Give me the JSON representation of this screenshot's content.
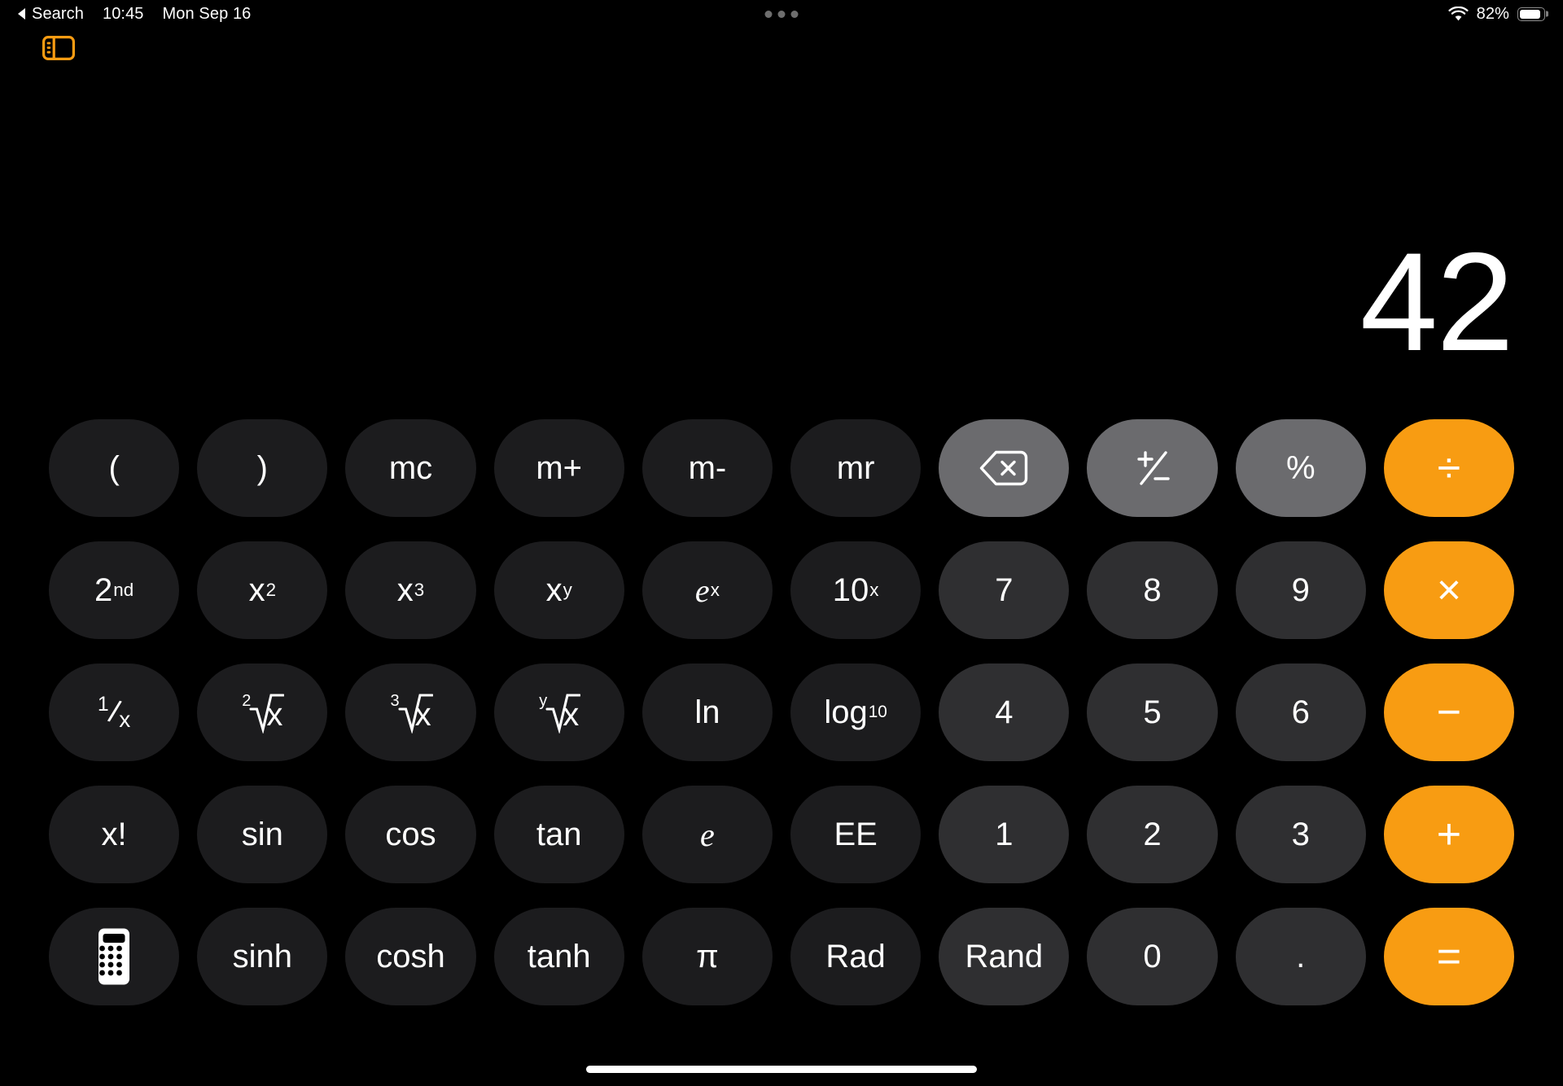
{
  "status_bar": {
    "back_label": "Search",
    "time": "10:45",
    "date": "Mon Sep 16",
    "wifi_icon": "wifi-icon",
    "battery_percent": "82%",
    "battery_level": 82,
    "multitask_icon": "multitask-dots-icon"
  },
  "toolbar": {
    "sidebar_toggle_icon": "sidebar-history-icon",
    "accent_color": "#F89C12"
  },
  "display": {
    "value": "42"
  },
  "colors": {
    "background": "#000000",
    "function_key": "#1C1C1E",
    "number_key": "#2F2F31",
    "utility_key": "#6B6B6E",
    "operator_key": "#F89C12",
    "key_text": "#FFFFFF"
  },
  "keypad": {
    "rows": [
      {
        "keys": [
          {
            "name": "open-paren-key",
            "label": "(",
            "type": "fn",
            "kind": "text"
          },
          {
            "name": "close-paren-key",
            "label": ")",
            "type": "fn",
            "kind": "text"
          },
          {
            "name": "memory-clear-key",
            "label": "mc",
            "type": "fn",
            "kind": "text"
          },
          {
            "name": "memory-add-key",
            "label": "m+",
            "type": "fn",
            "kind": "text"
          },
          {
            "name": "memory-subtract-key",
            "label": "m-",
            "type": "fn",
            "kind": "text"
          },
          {
            "name": "memory-recall-key",
            "label": "mr",
            "type": "fn",
            "kind": "text"
          },
          {
            "name": "backspace-key",
            "label": "",
            "type": "util",
            "kind": "icon",
            "icon": "backspace-delete-icon"
          },
          {
            "name": "sign-toggle-key",
            "label": "",
            "type": "util",
            "kind": "icon",
            "icon": "plus-minus-icon"
          },
          {
            "name": "percent-key",
            "label": "%",
            "type": "util",
            "kind": "text"
          },
          {
            "name": "divide-key",
            "label": "÷",
            "type": "op",
            "kind": "text"
          }
        ]
      },
      {
        "keys": [
          {
            "name": "second-function-key",
            "label": "2nd",
            "type": "fn",
            "kind": "sup",
            "base": "2",
            "sup": "nd"
          },
          {
            "name": "square-key",
            "label": "x2",
            "type": "fn",
            "kind": "sup",
            "base": "x",
            "sup": "2"
          },
          {
            "name": "cube-key",
            "label": "x3",
            "type": "fn",
            "kind": "sup",
            "base": "x",
            "sup": "3"
          },
          {
            "name": "power-y-key",
            "label": "xy",
            "type": "fn",
            "kind": "sup",
            "base": "x",
            "sup": "y"
          },
          {
            "name": "exp-e-key",
            "label": "ex",
            "type": "fn",
            "kind": "sup-ital",
            "base": "e",
            "sup": "x"
          },
          {
            "name": "exp-ten-key",
            "label": "10x",
            "type": "fn",
            "kind": "sup",
            "base": "10",
            "sup": "x"
          },
          {
            "name": "digit-7-key",
            "label": "7",
            "type": "num",
            "kind": "text"
          },
          {
            "name": "digit-8-key",
            "label": "8",
            "type": "num",
            "kind": "text"
          },
          {
            "name": "digit-9-key",
            "label": "9",
            "type": "num",
            "kind": "text"
          },
          {
            "name": "multiply-key",
            "label": "×",
            "type": "op",
            "kind": "text"
          }
        ]
      },
      {
        "keys": [
          {
            "name": "reciprocal-key",
            "label": "1/x",
            "type": "fn",
            "kind": "frac",
            "num": "1",
            "den": "x"
          },
          {
            "name": "square-root-key",
            "label": "2√x",
            "type": "fn",
            "kind": "radical",
            "index": "2"
          },
          {
            "name": "cube-root-key",
            "label": "3√x",
            "type": "fn",
            "kind": "radical",
            "index": "3"
          },
          {
            "name": "nth-root-key",
            "label": "y√x",
            "type": "fn",
            "kind": "radical",
            "index": "y"
          },
          {
            "name": "natural-log-key",
            "label": "ln",
            "type": "fn",
            "kind": "text"
          },
          {
            "name": "log-base-ten-key",
            "label": "log10",
            "type": "fn",
            "kind": "sub",
            "base": "log",
            "sub": "10"
          },
          {
            "name": "digit-4-key",
            "label": "4",
            "type": "num",
            "kind": "text"
          },
          {
            "name": "digit-5-key",
            "label": "5",
            "type": "num",
            "kind": "text"
          },
          {
            "name": "digit-6-key",
            "label": "6",
            "type": "num",
            "kind": "text"
          },
          {
            "name": "subtract-key",
            "label": "−",
            "type": "op",
            "kind": "text"
          }
        ]
      },
      {
        "keys": [
          {
            "name": "factorial-key",
            "label": "x!",
            "type": "fn",
            "kind": "text"
          },
          {
            "name": "sine-key",
            "label": "sin",
            "type": "fn",
            "kind": "text"
          },
          {
            "name": "cosine-key",
            "label": "cos",
            "type": "fn",
            "kind": "text"
          },
          {
            "name": "tangent-key",
            "label": "tan",
            "type": "fn",
            "kind": "text"
          },
          {
            "name": "euler-e-key",
            "label": "e",
            "type": "fn",
            "kind": "ital"
          },
          {
            "name": "ee-key",
            "label": "EE",
            "type": "fn",
            "kind": "text"
          },
          {
            "name": "digit-1-key",
            "label": "1",
            "type": "num",
            "kind": "text"
          },
          {
            "name": "digit-2-key",
            "label": "2",
            "type": "num",
            "kind": "text"
          },
          {
            "name": "digit-3-key",
            "label": "3",
            "type": "num",
            "kind": "text"
          },
          {
            "name": "add-key",
            "label": "+",
            "type": "op",
            "kind": "text"
          }
        ]
      },
      {
        "keys": [
          {
            "name": "basic-calculator-key",
            "label": "",
            "type": "fn",
            "kind": "icon",
            "icon": "calculator-icon"
          },
          {
            "name": "hyperbolic-sine-key",
            "label": "sinh",
            "type": "fn",
            "kind": "text"
          },
          {
            "name": "hyperbolic-cosine-key",
            "label": "cosh",
            "type": "fn",
            "kind": "text"
          },
          {
            "name": "hyperbolic-tangent-key",
            "label": "tanh",
            "type": "fn",
            "kind": "text"
          },
          {
            "name": "pi-key",
            "label": "π",
            "type": "fn",
            "kind": "text"
          },
          {
            "name": "radians-key",
            "label": "Rad",
            "type": "fn",
            "kind": "text"
          },
          {
            "name": "random-key",
            "label": "Rand",
            "type": "num",
            "kind": "text"
          },
          {
            "name": "digit-0-key",
            "label": "0",
            "type": "num",
            "kind": "text"
          },
          {
            "name": "decimal-point-key",
            "label": ".",
            "type": "num",
            "kind": "text"
          },
          {
            "name": "equals-key",
            "label": "=",
            "type": "op",
            "kind": "text"
          }
        ]
      }
    ]
  },
  "home_indicator": {
    "name": "home-indicator"
  }
}
